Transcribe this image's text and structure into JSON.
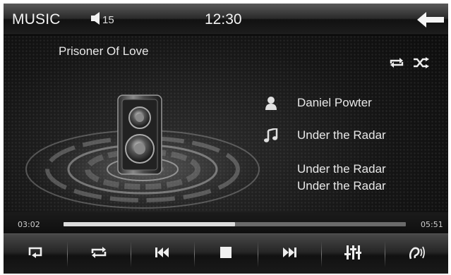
{
  "header": {
    "title": "MUSIC",
    "volume": "15",
    "time": "12:30"
  },
  "track": {
    "title": "Prisoner Of  Love",
    "artist": "Daniel Powter",
    "album": "Under the Radar",
    "extra_lines": [
      "Under the Radar",
      "Under the Radar"
    ]
  },
  "playback": {
    "elapsed": "03:02",
    "total": "05:51",
    "progress_fraction": 0.5
  },
  "toolbar_icons": [
    "repeat-list-icon",
    "repeat-icon",
    "previous-icon",
    "stop-icon",
    "next-icon",
    "equalizer-icon",
    "audio-output-icon"
  ],
  "colors": {
    "accent": "#ffffff",
    "background": "#151515"
  }
}
